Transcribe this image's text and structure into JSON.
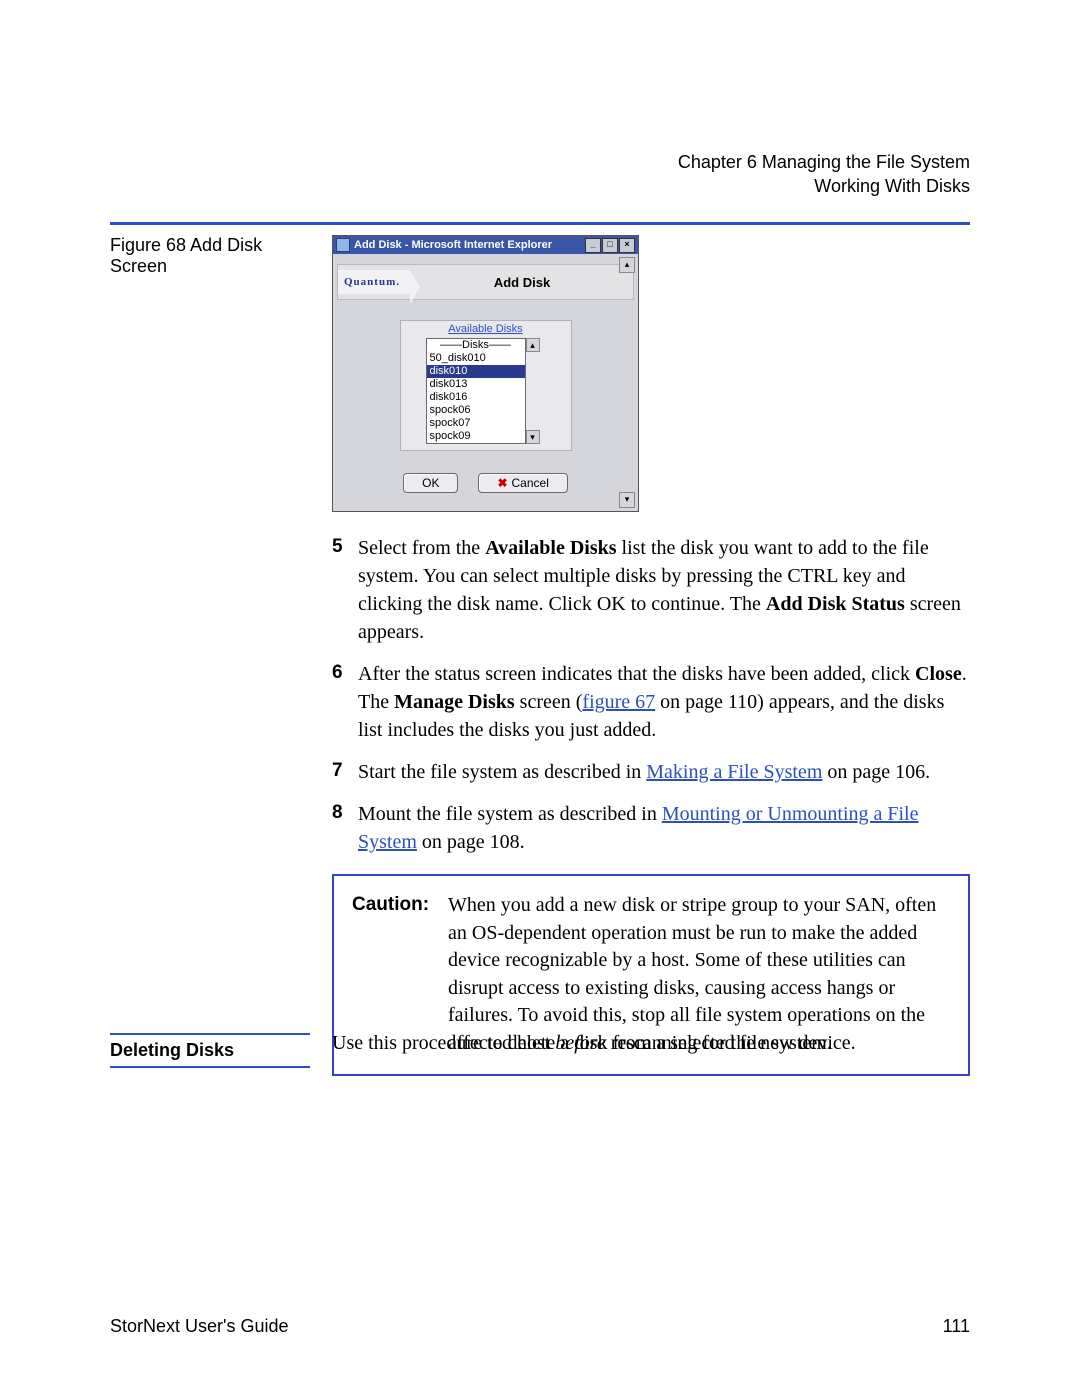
{
  "header": {
    "chapter": "Chapter 6  Managing the File System",
    "section": "Working With Disks"
  },
  "figure": {
    "label": "Figure 68  Add Disk Screen"
  },
  "app": {
    "window_title": "Add Disk - Microsoft Internet Explorer",
    "brand": "Quantum.",
    "page_title": "Add Disk",
    "available_label": "Available Disks",
    "list_header": "——Disks——",
    "items": {
      "i0": "50_disk010",
      "i1": "disk010",
      "i2": "disk013",
      "i3": "disk016",
      "i4": "spock06",
      "i5": "spock07",
      "i6": "spock09"
    },
    "ok": "OK",
    "cancel": "Cancel"
  },
  "steps": {
    "s5": {
      "num": "5",
      "pre": "Select from the ",
      "b1": "Available Disks",
      "mid": " list the disk you want to add to the file system. You can select multiple disks by pressing the CTRL key and clicking the disk name. Click OK to continue. The ",
      "b2": "Add Disk Status",
      "post": " screen appears."
    },
    "s6": {
      "num": "6",
      "pre": "After the status screen indicates that the disks have been added, click ",
      "b1": "Close",
      "mid1": ". The ",
      "b2": "Manage Disks",
      "mid2": " screen (",
      "link": "figure 67",
      "post": " on page 110) appears, and the disks list includes the disks you just added."
    },
    "s7": {
      "num": "7",
      "pre": "Start the file system as described in ",
      "link": "Making a File System",
      "post": " on page  106."
    },
    "s8": {
      "num": "8",
      "pre": "Mount the file system as described in ",
      "link": "Mounting or Unmounting a File System",
      "post": " on page  108."
    }
  },
  "caution": {
    "label": "Caution:",
    "t1": "When you add a new disk or stripe group to your SAN, often an OS-dependent operation must be run to make the added device recognizable by a host. Some of these utilities can disrupt access to existing disks, causing access hangs or failures. To avoid this, stop all file system operations on the affected host ",
    "italic": "before",
    "t2": " rescanning for the new device."
  },
  "subhead": {
    "label": "Deleting Disks",
    "text": "Use this procedure to delete a disk from a selected file system."
  },
  "footer": {
    "left": "StorNext User's Guide",
    "page": "111"
  }
}
